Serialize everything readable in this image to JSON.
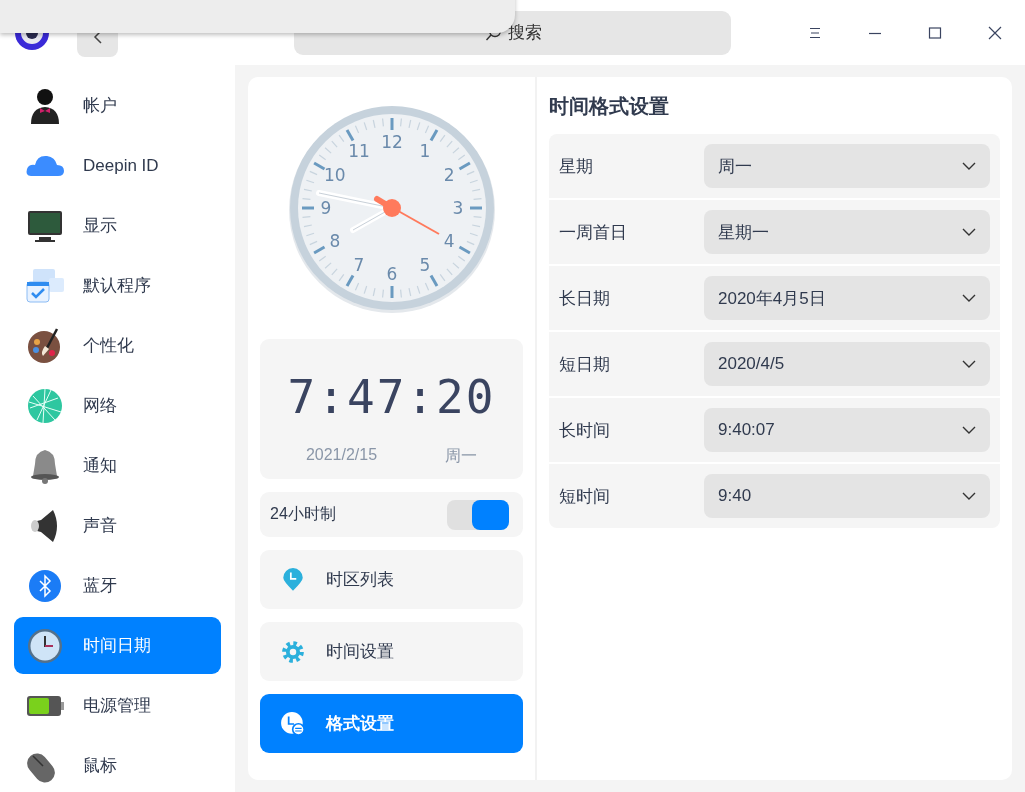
{
  "window": {
    "search": {
      "placeholder": "搜索"
    }
  },
  "sidebar": {
    "items": [
      {
        "label": "帐户",
        "selected": false
      },
      {
        "label": "Deepin ID",
        "selected": false
      },
      {
        "label": "显示",
        "selected": false
      },
      {
        "label": "默认程序",
        "selected": false
      },
      {
        "label": "个性化",
        "selected": false
      },
      {
        "label": "网络",
        "selected": false
      },
      {
        "label": "通知",
        "selected": false
      },
      {
        "label": "声音",
        "selected": false
      },
      {
        "label": "蓝牙",
        "selected": false
      },
      {
        "label": "时间日期",
        "selected": true
      },
      {
        "label": "电源管理",
        "selected": false
      },
      {
        "label": "鼠标",
        "selected": false
      }
    ]
  },
  "clock": {
    "numbers": [
      "1",
      "2",
      "3",
      "4",
      "5",
      "6",
      "7",
      "8",
      "9",
      "10",
      "11",
      "12"
    ]
  },
  "digital_clock": {
    "time": "7:47:20",
    "date": "2021/2/15",
    "weekday": "周一"
  },
  "hour_format": {
    "label": "24小时制",
    "on": true
  },
  "nav": [
    {
      "label": "时区列表",
      "selected": false
    },
    {
      "label": "时间设置",
      "selected": false
    },
    {
      "label": "格式设置",
      "selected": true
    }
  ],
  "format_settings": {
    "title": "时间格式设置",
    "rows": [
      {
        "label": "星期",
        "value": "周一"
      },
      {
        "label": "一周首日",
        "value": "星期一"
      },
      {
        "label": "长日期",
        "value": "2020年4月5日"
      },
      {
        "label": "短日期",
        "value": "2020/4/5"
      },
      {
        "label": "长时间",
        "value": "9:40:07"
      },
      {
        "label": "短时间",
        "value": "9:40"
      }
    ]
  }
}
